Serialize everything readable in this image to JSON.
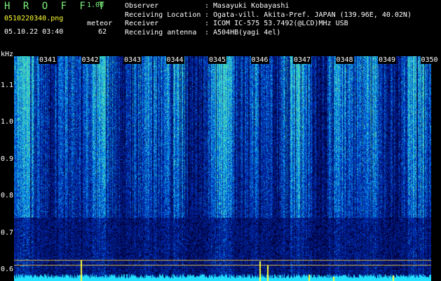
{
  "header": {
    "brand": "H R O F F T",
    "version": "1.00",
    "filename": "0510220340.png",
    "datetime": "05.10.22 03:40",
    "meteor_label": "meteor",
    "meteor_count": "62"
  },
  "info": [
    {
      "key": "Observer",
      "sep": ":",
      "value": "Masayuki Kobayashi"
    },
    {
      "key": "Receiving Location",
      "sep": ":",
      "value": "Ogata-vill. Akita-Pref. JAPAN (139.96E, 40.02N)"
    },
    {
      "key": "Receiver",
      "sep": ":",
      "value": "ICOM IC-575 53.7492(@LCD)MHz USB"
    },
    {
      "key": "Receiving antenna",
      "sep": ":",
      "value": "A504HB(yagi 4el)"
    }
  ],
  "axis": {
    "unit": "kHz",
    "y_ticks": [
      {
        "label": "1.1",
        "value": 1.1
      },
      {
        "label": "1.0",
        "value": 1.0
      },
      {
        "label": "0.9",
        "value": 0.9
      },
      {
        "label": "0.8",
        "value": 0.8
      },
      {
        "label": "0.7",
        "value": 0.7
      },
      {
        "label": "0.6",
        "value": 0.6
      }
    ],
    "y_range": [
      0.57,
      1.18
    ],
    "time_ticks": [
      "0341",
      "0342",
      "0343",
      "0344",
      "0345",
      "0346",
      "0347",
      "0348",
      "0349",
      "0350"
    ]
  },
  "colors": {
    "background": "#000000",
    "spectrum_deep": "#0a1f8c",
    "spectrum_mid": "#1e5fd0",
    "spectrum_hot": "#40d0a0",
    "power_trace": "#22e0ff",
    "meteor_spike": "#ffff33",
    "reference_line": "#ffd040",
    "label_green": "#7cf07c"
  }
}
